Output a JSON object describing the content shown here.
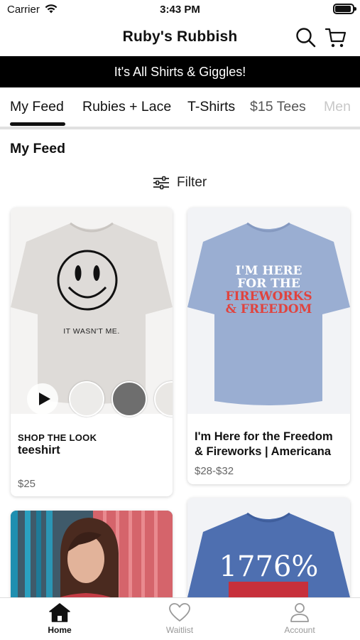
{
  "status_bar": {
    "carrier": "Carrier",
    "time": "3:43 PM"
  },
  "header": {
    "title": "Ruby's Rubbish",
    "icons": [
      "search-icon",
      "cart-icon"
    ]
  },
  "banner": {
    "text": "It's All Shirts & Giggles!"
  },
  "tabs": [
    {
      "label": "My Feed",
      "active": true
    },
    {
      "label": "Rubies + Lace"
    },
    {
      "label": "T-Shirts"
    },
    {
      "label": "$15 Tees"
    },
    {
      "label": "Men"
    }
  ],
  "feed": {
    "title": "My Feed",
    "filter_label": "Filter",
    "products": [
      {
        "overline": "SHOP THE LOOK",
        "name": "teeshirt",
        "price": "$25",
        "shirt_text": "IT WASN'T ME.",
        "shirt_color": "#dedbd8"
      },
      {
        "overline": "",
        "name": "I'm Here for the Freedom & Fireworks | Americana",
        "price": "$28-$32",
        "shirt_text_lines": [
          "I'M HERE",
          "FOR THE",
          "FIREWORKS",
          "& FREEDOM"
        ],
        "shirt_color": "#9aaed2"
      },
      {
        "overline": "",
        "name": "",
        "price": ""
      },
      {
        "overline": "",
        "name": "",
        "price": "",
        "shirt_text": "1776%",
        "shirt_color": "#4e6fb0"
      }
    ]
  },
  "tabbar": {
    "items": [
      {
        "label": "Home",
        "icon": "home-icon",
        "active": true
      },
      {
        "label": "Waitlist",
        "icon": "heart-icon"
      },
      {
        "label": "Account",
        "icon": "person-icon"
      }
    ]
  },
  "colors": {
    "banner_bg": "#000000",
    "accent": "#111111",
    "muted_text": "#999999",
    "divider": "#e1e1e1"
  }
}
